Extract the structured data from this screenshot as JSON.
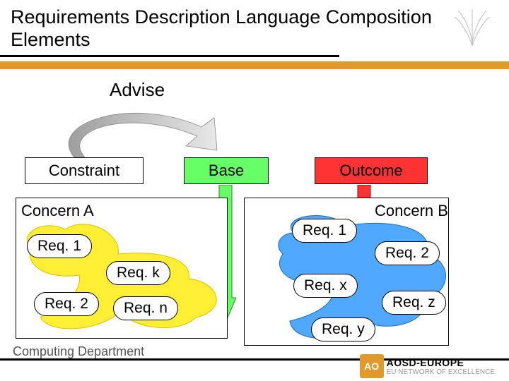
{
  "title": "Requirements Description Language Composition Elements",
  "advise": "Advise",
  "topboxes": {
    "constraint": "Constraint",
    "base": "Base",
    "outcome": "Outcome"
  },
  "concernA": {
    "label": "Concern A",
    "req1": "Req. 1",
    "reqk": "Req. k",
    "req2": "Req. 2",
    "reqn": "Req. n"
  },
  "concernB": {
    "label": "Concern B",
    "req1": "Req. 1",
    "req2": "Req. 2",
    "reqx": "Req. x",
    "reqz": "Req. z",
    "reqy": "Req. y"
  },
  "footer": {
    "dept": "Computing Department",
    "brand": "AOSD-EUROPE",
    "tagline": "EU NETWORK OF EXCELLENCE"
  }
}
